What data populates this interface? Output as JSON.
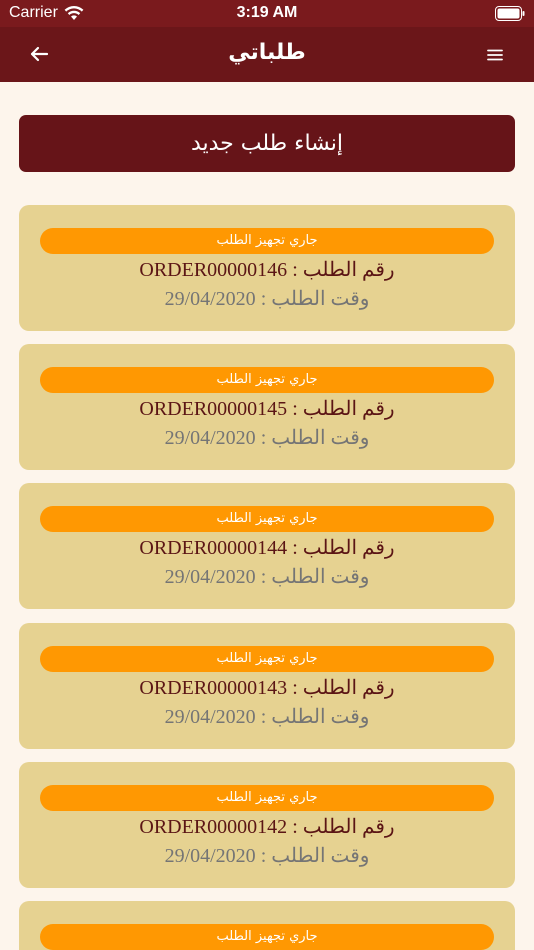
{
  "status_bar": {
    "carrier": "Carrier",
    "time": "3:19 AM"
  },
  "header": {
    "title": "طلباتي",
    "back_icon": "arrow-left-icon",
    "menu_icon": "hamburger-menu-icon"
  },
  "create_button": {
    "label": "إنشاء طلب جديد"
  },
  "orders": [
    {
      "status": "جاري تجهيز الطلب",
      "number_line": "رقم الطلب : ORDER00000146",
      "date_line": "وقت الطلب : 29/04/2020"
    },
    {
      "status": "جاري تجهيز الطلب",
      "number_line": "رقم الطلب : ORDER00000145",
      "date_line": "وقت الطلب : 29/04/2020"
    },
    {
      "status": "جاري تجهيز الطلب",
      "number_line": "رقم الطلب : ORDER00000144",
      "date_line": "وقت الطلب : 29/04/2020"
    },
    {
      "status": "جاري تجهيز الطلب",
      "number_line": "رقم الطلب : ORDER00000143",
      "date_line": "وقت الطلب : 29/04/2020"
    },
    {
      "status": "جاري تجهيز الطلب",
      "number_line": "رقم الطلب : ORDER00000142",
      "date_line": "وقت الطلب : 29/04/2020"
    },
    {
      "status": "جاري تجهيز الطلب"
    }
  ],
  "colors": {
    "status_bar": "#7a1a1d",
    "nav_bar": "#6b1619",
    "primary_button": "#661418",
    "card_background": "#e6d291",
    "status_pill": "#ff9802",
    "page_background": "#fdf5ec"
  }
}
